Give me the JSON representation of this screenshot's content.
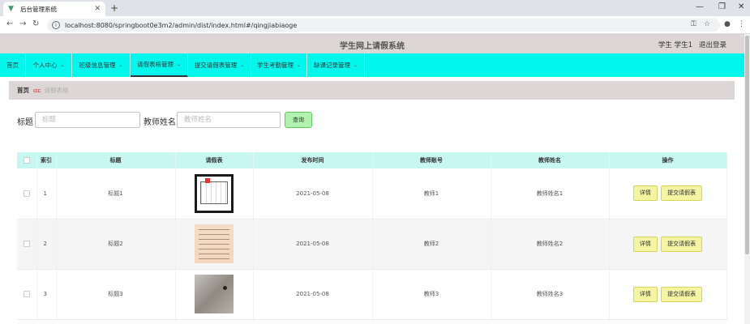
{
  "browser": {
    "tab_title": "后台管理系统",
    "url": "localhost:8080/springboot0e3m2/admin/dist/index.html#/qingjiabiaoge"
  },
  "header": {
    "title": "学生网上请假系统",
    "user": "学生 学生1",
    "logout": "退出登录"
  },
  "nav": {
    "items": [
      {
        "label": "首页",
        "dropdown": false,
        "active": false
      },
      {
        "label": "个人中心",
        "dropdown": true,
        "active": false
      },
      {
        "label": "班级信息管理",
        "dropdown": true,
        "active": false
      },
      {
        "label": "请假表格管理",
        "dropdown": true,
        "active": true
      },
      {
        "label": "提交请假表管理",
        "dropdown": true,
        "active": false
      },
      {
        "label": "学生考勤管理",
        "dropdown": true,
        "active": false
      },
      {
        "label": "缺课记录管理",
        "dropdown": true,
        "active": false
      }
    ]
  },
  "breadcrumb": {
    "home": "首页",
    "separator": "ccc",
    "current": "请假表格"
  },
  "search": {
    "title_label": "标题",
    "title_placeholder": "标题",
    "teacher_label": "教师姓名",
    "teacher_placeholder": "教师姓名",
    "query_button": "查询"
  },
  "table": {
    "columns": [
      "索引",
      "标题",
      "请假表",
      "发布时间",
      "教师账号",
      "教师姓名",
      "操作"
    ],
    "rows": [
      {
        "index": "1",
        "title": "标题1",
        "time": "2021-05-08",
        "account": "教师1",
        "name": "教师姓名1",
        "highlight": true
      },
      {
        "index": "2",
        "title": "标题2",
        "time": "2021-05-08",
        "account": "教师2",
        "name": "教师姓名2",
        "highlight": false
      },
      {
        "index": "3",
        "title": "标题3",
        "time": "2021-05-08",
        "account": "教师3",
        "name": "教师姓名3",
        "highlight": true
      }
    ],
    "detail_button": "详情",
    "submit_button": "提交请假表"
  },
  "colors": {
    "nav_bg": "#00f7ec",
    "header_bg": "#ddd6d6",
    "table_header_bg": "#c8f6f0",
    "query_btn_bg": "#aef2ad",
    "op_btn_bg": "#f4f4a3",
    "link": "#3a8ee6"
  }
}
